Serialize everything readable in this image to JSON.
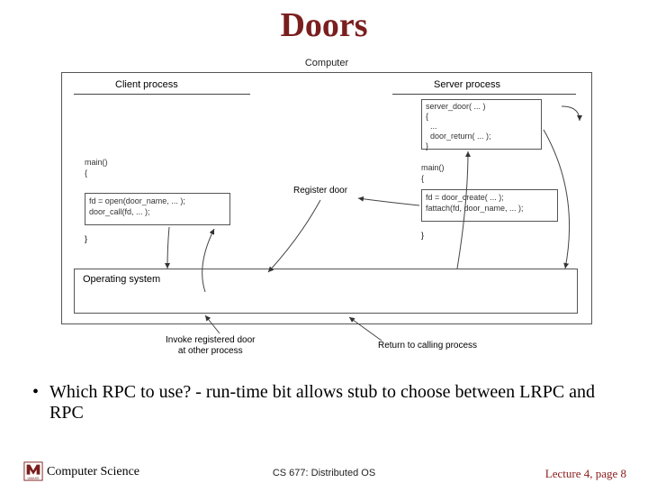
{
  "title": "Doors",
  "diagram": {
    "computer": "Computer",
    "client_process": "Client process",
    "server_process": "Server process",
    "client": {
      "main": "main()\n{",
      "code": "fd = open(door_name, ... );\ndoor_call(fd, ... );",
      "close": "}"
    },
    "register_door": "Register door",
    "server": {
      "door_box": "server_door( ... )\n{\n  ...\n  door_return( ... );\n}",
      "main": "main()\n{",
      "code": "fd = door_create( ... );\nfattach(fd, door_name, ... );",
      "close": "}"
    },
    "os": "Operating system",
    "invoke": "Invoke registered door\nat other process",
    "return": "Return to calling process"
  },
  "bullet": "Which RPC to use?  - run-time bit allows stub to choose between LRPC and RPC",
  "footer": {
    "dept": "Computer Science",
    "course": "CS 677: Distributed OS",
    "page": "Lecture 4, page 8"
  }
}
